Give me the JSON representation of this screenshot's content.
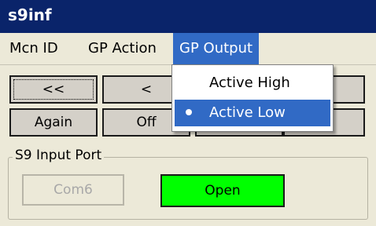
{
  "window": {
    "title": "s9inf"
  },
  "menubar": {
    "items": [
      {
        "label": "Mcn ID"
      },
      {
        "label": "GP Action"
      },
      {
        "label": "GP Output"
      }
    ]
  },
  "toolbar": {
    "row1": [
      {
        "label": "<<"
      },
      {
        "label": "<"
      },
      {
        "label": ""
      },
      {
        "label": ""
      }
    ],
    "row2": [
      {
        "label": "Again"
      },
      {
        "label": "Off"
      },
      {
        "label": ""
      },
      {
        "label": ""
      }
    ]
  },
  "input_port": {
    "group_label": "S9 Input Port",
    "com_button": "Com6",
    "open_button": "Open",
    "open_color": "#00ff00"
  },
  "gp_output_menu": {
    "items": [
      {
        "label": "Active High",
        "selected": false
      },
      {
        "label": "Active Low",
        "selected": true
      }
    ]
  }
}
